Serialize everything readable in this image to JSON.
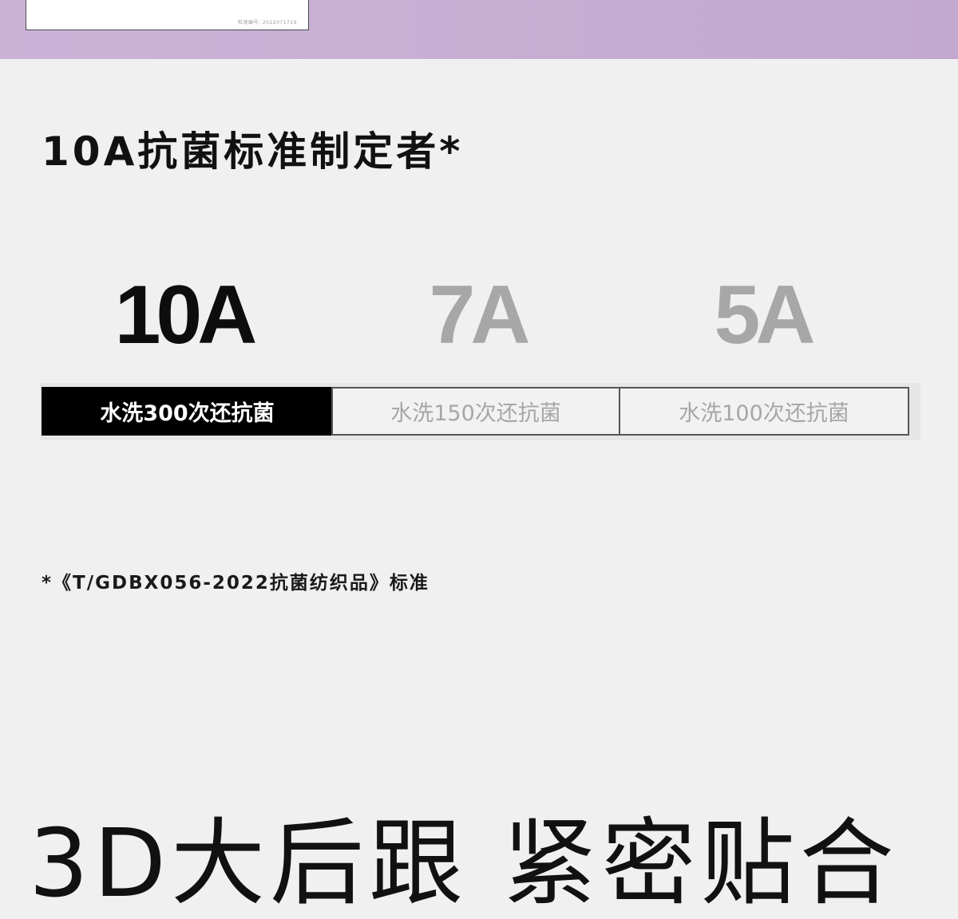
{
  "certificate": {
    "footer_line": "检测编号: 2022071719"
  },
  "headline": "10A抗菌标准制定者*",
  "grades": [
    {
      "grade": "10A",
      "wash_note": "水洗300次还抗菌",
      "highlighted": true
    },
    {
      "grade": "7A",
      "wash_note": "水洗150次还抗菌",
      "highlighted": false
    },
    {
      "grade": "5A",
      "wash_note": "水洗100次还抗菌",
      "highlighted": false
    }
  ],
  "footnote": "*《T/GDBX056-2022抗菌纺织品》标准",
  "next_section_heading": "3D大后跟 紧密贴合",
  "colors": {
    "top_band": "#c7aed3",
    "background": "#f0f0f0",
    "highlight": "#000000",
    "muted_text": "#a7a7a7"
  }
}
